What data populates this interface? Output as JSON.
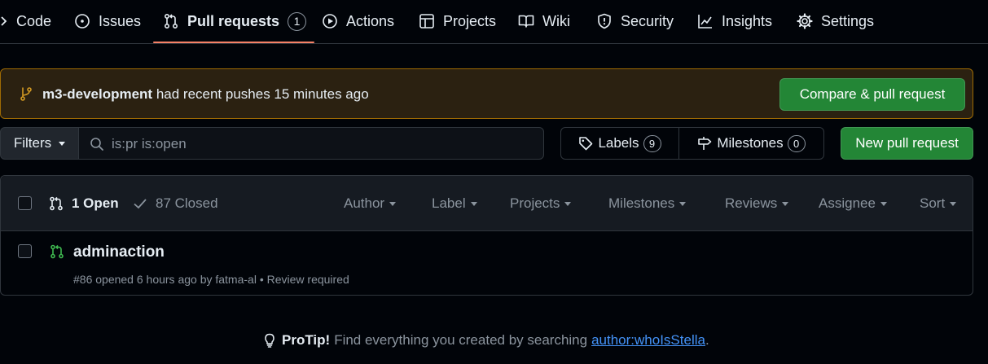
{
  "nav": {
    "tabs": [
      {
        "label": "Code",
        "icon": "chevron-right-icon"
      },
      {
        "label": "Issues",
        "icon": "issue-opened-icon"
      },
      {
        "label": "Pull requests",
        "icon": "git-pull-request-icon",
        "count": "1",
        "active": true
      },
      {
        "label": "Actions",
        "icon": "play-icon"
      },
      {
        "label": "Projects",
        "icon": "table-icon"
      },
      {
        "label": "Wiki",
        "icon": "book-icon"
      },
      {
        "label": "Security",
        "icon": "shield-icon"
      },
      {
        "label": "Insights",
        "icon": "graph-icon"
      },
      {
        "label": "Settings",
        "icon": "gear-icon"
      }
    ]
  },
  "banner": {
    "branch": "m3-development",
    "message": " had recent pushes 15 minutes ago",
    "button": "Compare & pull request"
  },
  "filters": {
    "button": "Filters",
    "search_value": "is:pr is:open",
    "labels_label": "Labels",
    "labels_count": "9",
    "milestones_label": "Milestones",
    "milestones_count": "0",
    "new_button": "New pull request"
  },
  "list_header": {
    "open_label": "1 Open",
    "closed_label": "87 Closed",
    "filters": [
      "Author",
      "Label",
      "Projects",
      "Milestones",
      "Reviews",
      "Assignee",
      "Sort"
    ]
  },
  "pull_requests": [
    {
      "title": "adminaction",
      "meta": "#86 opened 6 hours ago by fatma-al • Review required"
    }
  ],
  "protip": {
    "lead": "ProTip!",
    "text": "Find everything you created by searching",
    "link": "author:whoIsStella",
    "trailing": "."
  },
  "colors": {
    "background": "#010409",
    "accent_green": "#238636",
    "open_icon": "#3fb950",
    "banner_bg": "#2b2111",
    "banner_border": "#9e6a03",
    "active_underline": "#f78166",
    "link": "#4493f8"
  }
}
